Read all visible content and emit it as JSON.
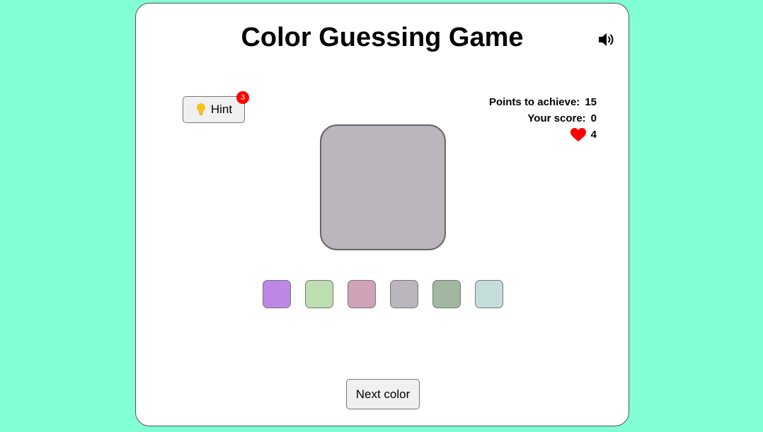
{
  "game": {
    "title": "Color Guessing Game",
    "sound_icon": "speaker-volume-icon",
    "hint": {
      "label": "Hint",
      "icon": "lightbulb-icon",
      "remaining": "3"
    },
    "stats": {
      "points_label": "Points to achieve:",
      "points_value": "15",
      "score_label": "Your score:",
      "score_value": "0",
      "lives_icon": "heart-icon",
      "lives_value": "4"
    },
    "target_color": "#bbb6bd",
    "options": [
      {
        "color": "#be87e5"
      },
      {
        "color": "#bcdeb1"
      },
      {
        "color": "#cfa2b8"
      },
      {
        "color": "#bbb6bd"
      },
      {
        "color": "#a2b7a0"
      },
      {
        "color": "#c4dddb"
      }
    ],
    "next_label": "Next color"
  },
  "colors": {
    "background": "#82ffd4",
    "badge": "#ff0000",
    "heart": "#ff0000",
    "bulb": "#f7c21c"
  }
}
